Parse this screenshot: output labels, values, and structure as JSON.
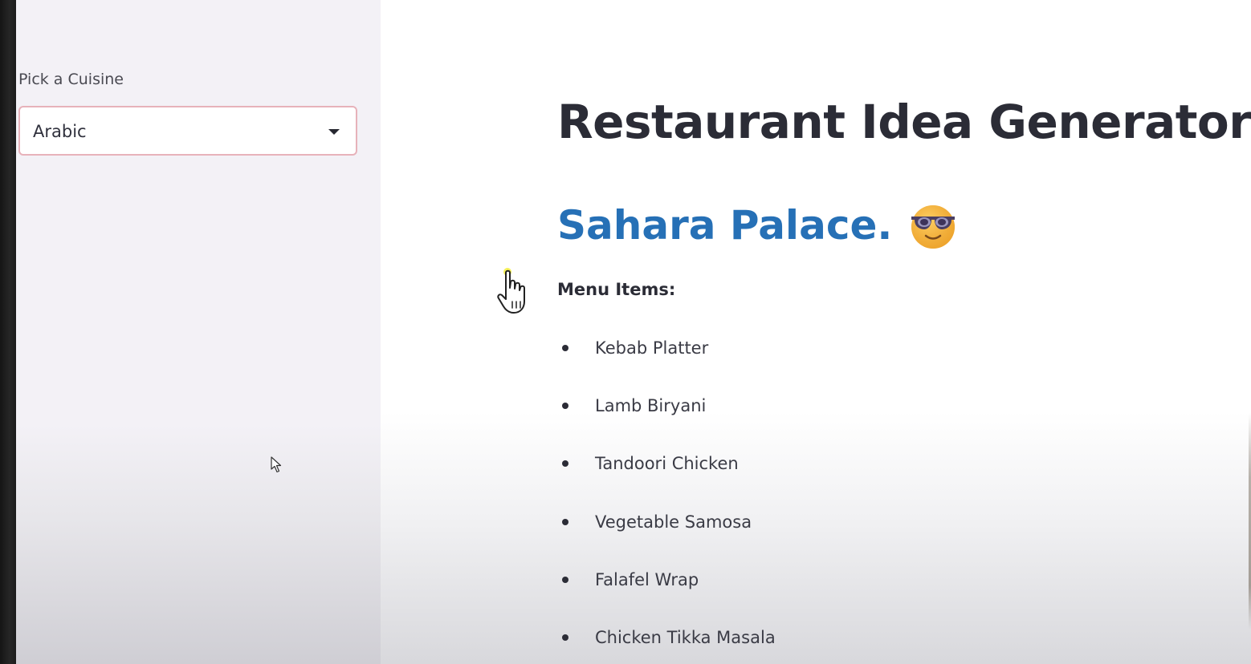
{
  "sidebar": {
    "cuisine_select": {
      "label": "Pick a Cuisine",
      "value": "Arabic"
    }
  },
  "main": {
    "title": "Restaurant Idea Generator",
    "restaurant_name": "Sahara Palace.",
    "emoji_icon": "smiling-face-with-sunglasses-icon",
    "menu_heading": "Menu Items:",
    "menu_items": [
      "Kebab Platter",
      "Lamb Biryani",
      "Tandoori Chicken",
      "Vegetable Samosa",
      "Falafel Wrap",
      "Chicken Tikka Masala"
    ]
  },
  "colors": {
    "accent_border": "#e7b2ba",
    "restaurant_name": "#2670b6",
    "sidebar_bg": "#f3f1f6"
  }
}
